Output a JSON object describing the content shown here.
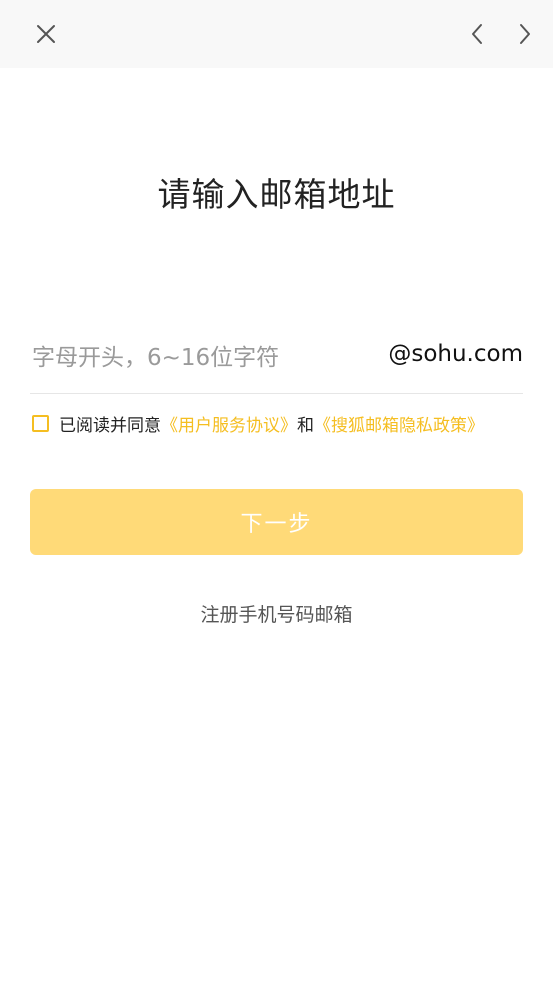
{
  "header": {
    "close_icon": "close-icon",
    "back_icon": "chevron-left-icon",
    "forward_icon": "chevron-right-icon"
  },
  "main": {
    "title": "请输入邮箱地址",
    "email": {
      "value": "",
      "placeholder": "字母开头，6~16位字符",
      "domain_suffix": "@sohu.com"
    },
    "agreement": {
      "checked": false,
      "prefix": "已阅读并同意",
      "user_agreement_link": "《用户服务协议》",
      "conjunction": "和",
      "privacy_policy_link": "《搜狐邮箱隐私政策》"
    },
    "next_button_label": "下一步",
    "phone_register_link": "注册手机号码邮箱"
  },
  "colors": {
    "accent": "#f5be21",
    "button_disabled": "#ffda78",
    "topbar_background": "#f8f8f8"
  }
}
